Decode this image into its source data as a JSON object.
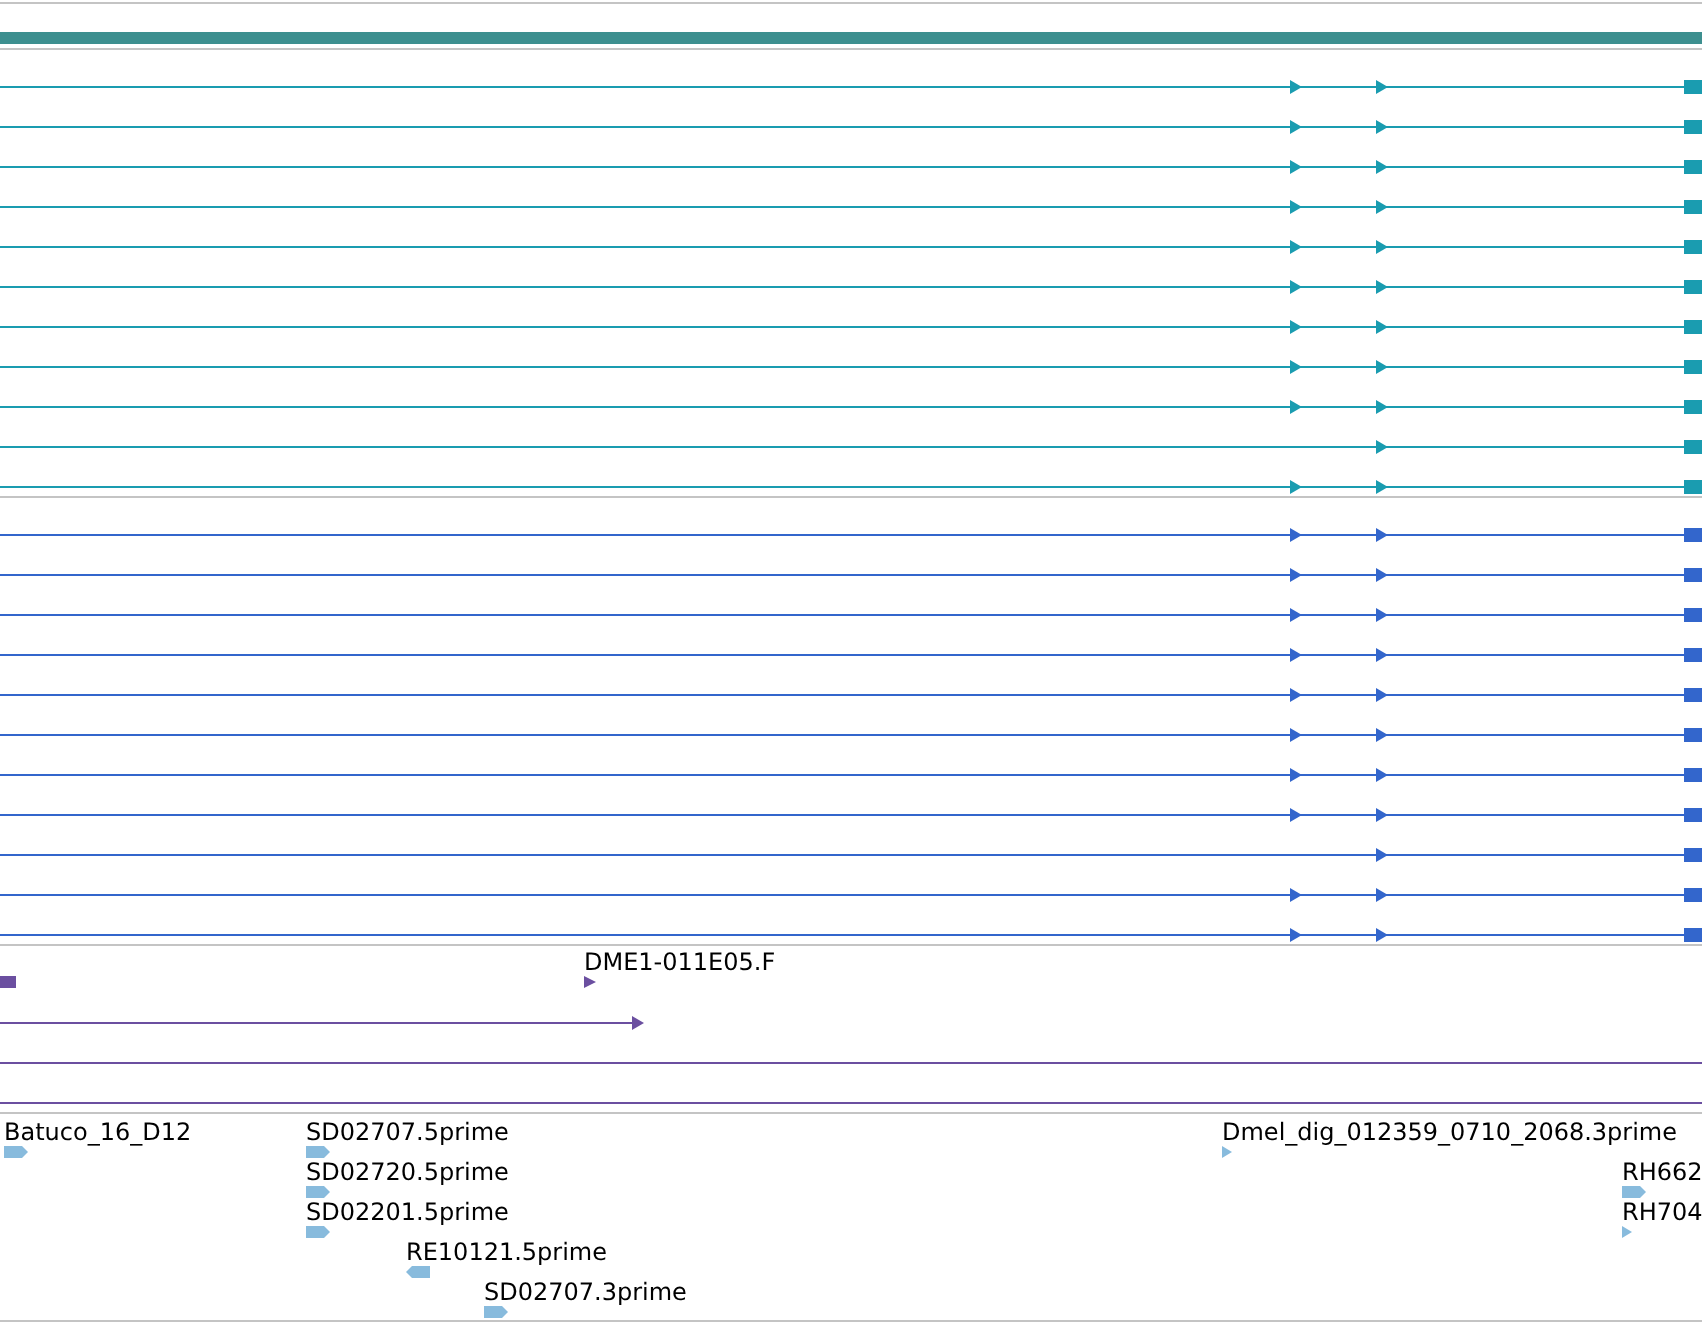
{
  "tracks": [
    {
      "kind": "transcripts",
      "color": "#1a9cb0",
      "rows": [
        {
          "arrow_1": true,
          "arrow_2": true
        },
        {
          "arrow_1": true,
          "arrow_2": true
        },
        {
          "arrow_1": true,
          "arrow_2": true
        },
        {
          "arrow_1": true,
          "arrow_2": true
        },
        {
          "arrow_1": true,
          "arrow_2": true
        },
        {
          "arrow_1": true,
          "arrow_2": true
        },
        {
          "arrow_1": true,
          "arrow_2": true
        },
        {
          "arrow_1": true,
          "arrow_2": true
        },
        {
          "arrow_1": true,
          "arrow_2": true
        },
        {
          "arrow_1": false,
          "arrow_2": true
        },
        {
          "arrow_1": true,
          "arrow_2": true
        }
      ]
    },
    {
      "kind": "transcripts",
      "color": "#3366cc",
      "rows": [
        {
          "arrow_1": true,
          "arrow_2": true
        },
        {
          "arrow_1": true,
          "arrow_2": true
        },
        {
          "arrow_1": true,
          "arrow_2": true
        },
        {
          "arrow_1": true,
          "arrow_2": true
        },
        {
          "arrow_1": true,
          "arrow_2": true
        },
        {
          "arrow_1": true,
          "arrow_2": true
        },
        {
          "arrow_1": true,
          "arrow_2": true
        },
        {
          "arrow_1": true,
          "arrow_2": true
        },
        {
          "arrow_1": false,
          "arrow_2": true
        },
        {
          "arrow_1": true,
          "arrow_2": true
        },
        {
          "arrow_1": true,
          "arrow_2": true
        }
      ]
    },
    {
      "kind": "alignments",
      "color": "#6b4fa0",
      "label": "DME1-011E05.F"
    },
    {
      "kind": "ests",
      "color": "#88bbdd",
      "features": [
        {
          "label": "Batuco_16_D12",
          "kind": "right"
        },
        {
          "label": "SD02707.5prime",
          "kind": "right"
        },
        {
          "label": "SD02720.5prime",
          "kind": "right"
        },
        {
          "label": "SD02201.5prime",
          "kind": "right"
        },
        {
          "label": "RE10121.5prime",
          "kind": "left"
        },
        {
          "label": "SD02707.3prime",
          "kind": "right"
        },
        {
          "label": "Dmel_dig_012359_0710_2068.3prime",
          "kind": "small"
        },
        {
          "label": "RH662",
          "kind": "right"
        },
        {
          "label": "RH704",
          "kind": "small"
        }
      ]
    }
  ]
}
